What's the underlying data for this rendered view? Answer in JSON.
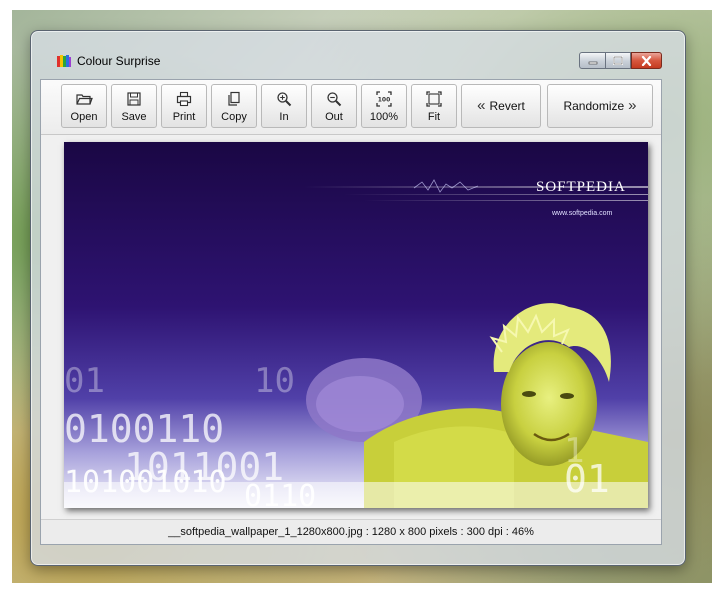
{
  "window": {
    "title": "Colour Surprise",
    "status": "__softpedia_wallpaper_1_1280x800.jpg : 1280 x 800 pixels : 300 dpi : 46%"
  },
  "toolbar": {
    "buttons": [
      {
        "label": "Open",
        "icon": "folder-open-icon"
      },
      {
        "label": "Save",
        "icon": "floppy-disk-icon"
      },
      {
        "label": "Print",
        "icon": "printer-icon"
      },
      {
        "label": "Copy",
        "icon": "copy-icon"
      },
      {
        "label": "In",
        "icon": "zoom-in-icon"
      },
      {
        "label": "Out",
        "icon": "zoom-out-icon"
      },
      {
        "label": "100%",
        "icon": "actual-size-icon"
      },
      {
        "label": "Fit",
        "icon": "fit-to-window-icon"
      }
    ],
    "revert_label": "Revert",
    "randomize_label": "Randomize"
  },
  "image": {
    "brand": "SOFTPEDIA",
    "url": "www.softpedia.com"
  },
  "colors": {
    "close_button": "#d6573f",
    "image_purple": "#2c1270"
  }
}
